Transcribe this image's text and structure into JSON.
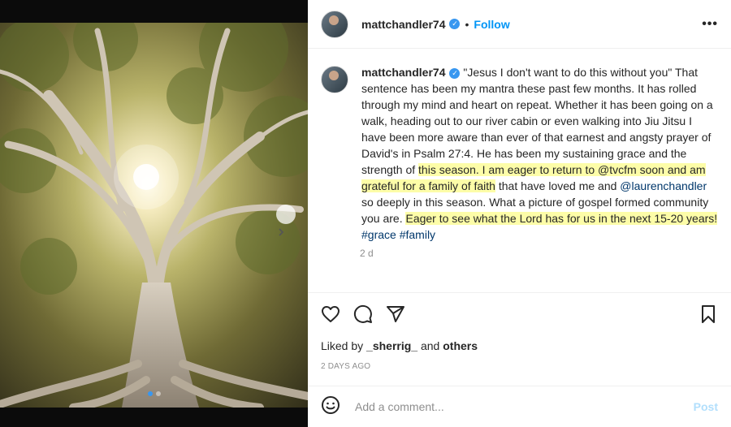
{
  "post": {
    "username": "mattchandler74",
    "follow_label": "Follow",
    "bullet": "•",
    "more_label": "•••",
    "caption": {
      "part1": "\"Jesus I don't want to do this without you\" That sentence has been my mantra these past few months. It has rolled through my mind and heart on repeat. Whether it has been going on a walk, heading out to our river cabin or even walking into Jiu Jitsu I have been more aware than ever of that earnest and angsty prayer of David's in Psalm 27:4. He has been my sustaining grace and the strength of ",
      "highlight1": "this season. I am eager to return to @tvcfm soon and am grateful for a family of faith",
      "part2": " that have loved me and ",
      "mention": "@laurenchandler",
      "part3": " so deeply in this season. What a picture of gospel formed community you are. ",
      "highlight2": "Eager to see what the Lord has for us in the next 15-20 years!",
      "hashtag1": "#grace",
      "hashtag2": "#family"
    },
    "caption_time": "2 d",
    "likes": {
      "prefix": "Liked by ",
      "user": "_sherrig_",
      "middle": " and ",
      "others": "others"
    },
    "date": "2 DAYS AGO",
    "comment": {
      "placeholder": "Add a comment...",
      "post_label": "Post"
    }
  },
  "icons": [
    "heart-icon",
    "comment-icon",
    "share-icon",
    "bookmark-icon",
    "emoji-icon",
    "verified-badge",
    "more-options-icon",
    "chevron-right-icon"
  ],
  "colors": {
    "accent": "#0095f6",
    "post_disabled": "#b2dffc",
    "highlight": "#fdfda8",
    "hashtag": "#00376b"
  },
  "carousel": {
    "slides": 2,
    "active": 1
  }
}
